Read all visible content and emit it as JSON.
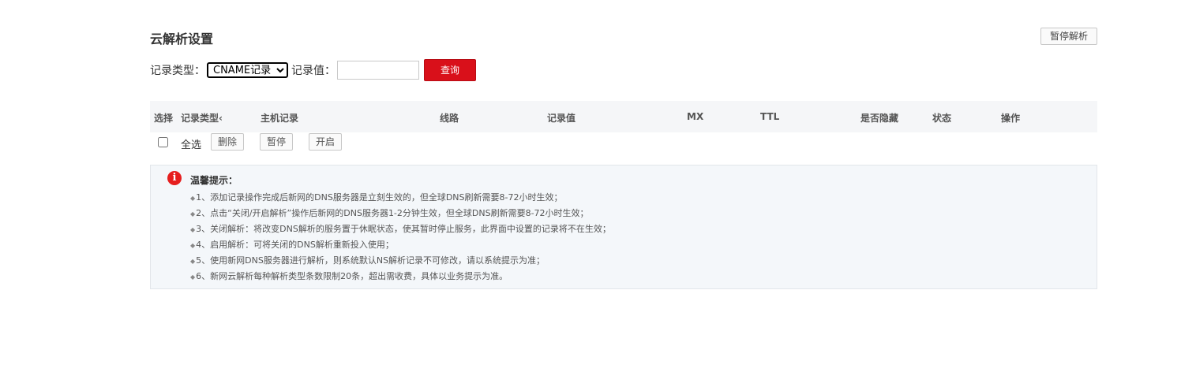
{
  "page": {
    "title": "云解析设置"
  },
  "header": {
    "pause_dns_label": "暂停解析"
  },
  "filter": {
    "record_type_label": "记录类型：",
    "record_type_selected": "CNAME记录",
    "record_value_label": "记录值：",
    "record_value": "",
    "query_label": "查询"
  },
  "table": {
    "columns": [
      "选择",
      "记录类型‹",
      "主机记录",
      "线路",
      "记录值",
      "MX",
      "TTL",
      "是否隐藏",
      "状态",
      "操作"
    ]
  },
  "actions": {
    "select_all_label": "全选",
    "delete_label": "删除",
    "pause_label": "暂停",
    "enable_label": "开启"
  },
  "tips": {
    "icon": "info-icon",
    "title": "温馨提示：",
    "items": [
      "1、添加记录操作完成后新网的DNS服务器是立刻生效的，但全球DNS刷新需要8-72小时生效；",
      "2、点击“关闭/开启解析”操作后新网的DNS服务器1-2分钟生效，但全球DNS刷新需要8-72小时生效；",
      "3、关闭解析：将改变DNS解析的服务置于休眠状态，使其暂时停止服务，此界面中设置的记录将不在生效；",
      "4、启用解析：可将关闭的DNS解析重新投入使用；",
      "5、使用新网DNS服务器进行解析，则系统默认NS解析记录不可修改，请以系统提示为准；",
      "6、新网云解析每种解析类型条数限制20条，超出需收费，具体以业务提示为准。"
    ]
  },
  "colors": {
    "accent": "#d9101a",
    "header_bg": "#f5f6f8",
    "tip_bg": "#f4f7fa",
    "info_icon": "#e61e1e"
  }
}
